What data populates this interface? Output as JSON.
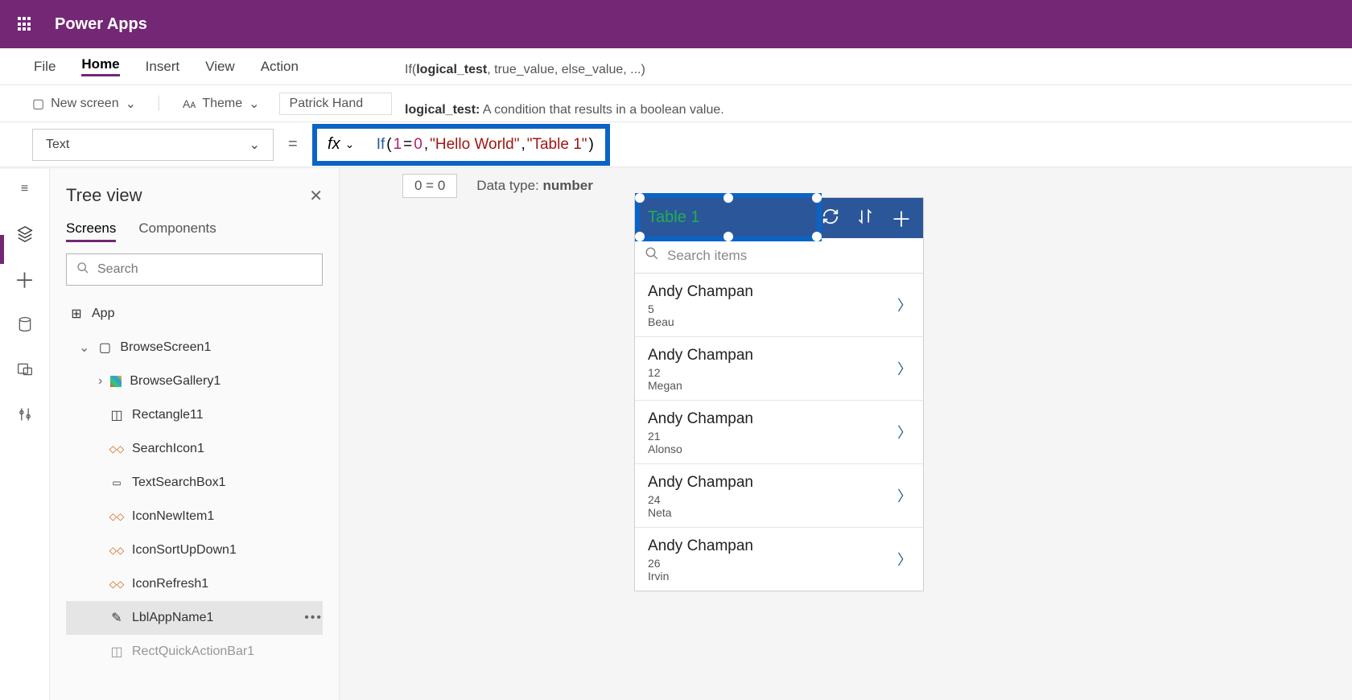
{
  "header": {
    "brand": "Power Apps"
  },
  "menubar": {
    "items": [
      "File",
      "Home",
      "Insert",
      "View",
      "Action"
    ],
    "active": "Home"
  },
  "ribbon": {
    "newscreen": "New screen",
    "theme": "Theme",
    "font": "Patrick Hand"
  },
  "hints": {
    "sig_prefix": "If(",
    "sig_b": "logical_test",
    "sig_rest": ", true_value, else_value, ...)",
    "desc_b": "logical_test:",
    "desc_rest": " A condition that results in a boolean value."
  },
  "formula": {
    "property": "Text",
    "fx": "fx",
    "raw": "If(1=0, \"Hello World\", \"Table 1\")",
    "tokens": {
      "fn": "If",
      "open": "(",
      "n1": "1",
      "eq": "=",
      "n2": "0",
      "c1": ", ",
      "s1": "\"Hello World\"",
      "c2": ", ",
      "s2": "\"Table 1\"",
      "close": ")"
    }
  },
  "result": {
    "expr": "0 = 0",
    "dt_label": "Data type: ",
    "dt": "number"
  },
  "tree": {
    "title": "Tree view",
    "tabs": {
      "screens": "Screens",
      "components": "Components"
    },
    "search_ph": "Search",
    "nodes": [
      {
        "label": "App",
        "level": 0,
        "icon": "app"
      },
      {
        "label": "BrowseScreen1",
        "level": 1,
        "icon": "screen",
        "chev": "v"
      },
      {
        "label": "BrowseGallery1",
        "level": 2,
        "icon": "gallery",
        "chev": ">"
      },
      {
        "label": "Rectangle11",
        "level": 3,
        "icon": "rect"
      },
      {
        "label": "SearchIcon1",
        "level": 3,
        "icon": "iconctl"
      },
      {
        "label": "TextSearchBox1",
        "level": 3,
        "icon": "textbox"
      },
      {
        "label": "IconNewItem1",
        "level": 3,
        "icon": "iconctl"
      },
      {
        "label": "IconSortUpDown1",
        "level": 3,
        "icon": "iconctl"
      },
      {
        "label": "IconRefresh1",
        "level": 3,
        "icon": "iconctl"
      },
      {
        "label": "LblAppName1",
        "level": 3,
        "icon": "label",
        "selected": true
      },
      {
        "label": "RectQuickActionBar1",
        "level": 3,
        "icon": "rect",
        "cut": true
      }
    ]
  },
  "phone": {
    "title": "Table 1",
    "search_ph": "Search items",
    "items": [
      {
        "name": "Andy Champan",
        "line1": "5",
        "line2": "Beau"
      },
      {
        "name": "Andy Champan",
        "line1": "12",
        "line2": "Megan"
      },
      {
        "name": "Andy Champan",
        "line1": "21",
        "line2": "Alonso"
      },
      {
        "name": "Andy Champan",
        "line1": "24",
        "line2": "Neta"
      },
      {
        "name": "Andy Champan",
        "line1": "26",
        "line2": "Irvin"
      }
    ]
  }
}
